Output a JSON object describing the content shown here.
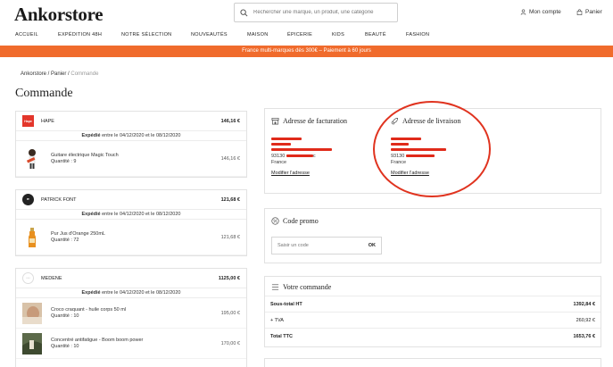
{
  "header": {
    "logo": "Ankorstore",
    "search_placeholder": "Rechercher une marque, un produit, une catégorie",
    "account": "Mon compte",
    "cart": "Panier"
  },
  "nav": [
    "ACCUEIL",
    "EXPÉDITION 48H",
    "NOTRE SÉLECTION",
    "NOUVEAUTÉS",
    "MAISON",
    "ÉPICERIE",
    "KIDS",
    "BEAUTÉ",
    "FASHION"
  ],
  "banner": "France multi-marques dès 300€ – Paiement à 60 jours",
  "breadcrumb": {
    "home": "Ankorstore",
    "cart": "Panier",
    "current": "Commande"
  },
  "page_title": "Commande",
  "orders": [
    {
      "brand": "HAPE",
      "total": "146,16 €",
      "shipping_bold": "Expédié",
      "shipping_text": "entre le 04/12/2020 et le 08/12/2020",
      "items": [
        {
          "name": "Guitare électrique Magic Touch",
          "qty": "Quantité : 9",
          "price": "146,16 €"
        }
      ]
    },
    {
      "brand": "PATRICK FONT",
      "total": "121,68 €",
      "shipping_bold": "Expédié",
      "shipping_text": "entre le 04/12/2020 et le 08/12/2020",
      "items": [
        {
          "name": "Pur Jus d'Orange 250mL",
          "qty": "Quantité : 72",
          "price": "121,68 €"
        }
      ]
    },
    {
      "brand": "MEDENE",
      "total": "1125,00 €",
      "shipping_bold": "Expédié",
      "shipping_text": "entre le 04/12/2020 et le 08/12/2020",
      "items": [
        {
          "name": "Croco craquant - huile corps 50 ml",
          "qty": "Quantité : 10",
          "price": "195,00 €"
        },
        {
          "name": "Concentré antifatigue - Boom boom power",
          "qty": "Quantité : 10",
          "price": "170,00 €"
        }
      ]
    }
  ],
  "billing": {
    "title": "Adresse de facturation",
    "postcode": "93130",
    "country": "France",
    "edit": "Modifier l'adresse"
  },
  "delivery": {
    "title": "Adresse de livraison",
    "postcode": "93130",
    "country": "France",
    "edit": "Modifier l'adresse"
  },
  "promo": {
    "title": "Code promo",
    "placeholder": "Saisir un code",
    "button": "OK"
  },
  "summary": {
    "title": "Votre commande",
    "rows": [
      {
        "label": "Sous-total HT",
        "value": "1392,84 €"
      },
      {
        "label": "+ TVA",
        "value": "260,92 €"
      },
      {
        "label": "Total TTC",
        "value": "1653,76 €"
      }
    ]
  },
  "colors": {
    "banner": "#f06b2c",
    "redaction": "#e02a1a",
    "annotation_circle": "#e0331f"
  }
}
